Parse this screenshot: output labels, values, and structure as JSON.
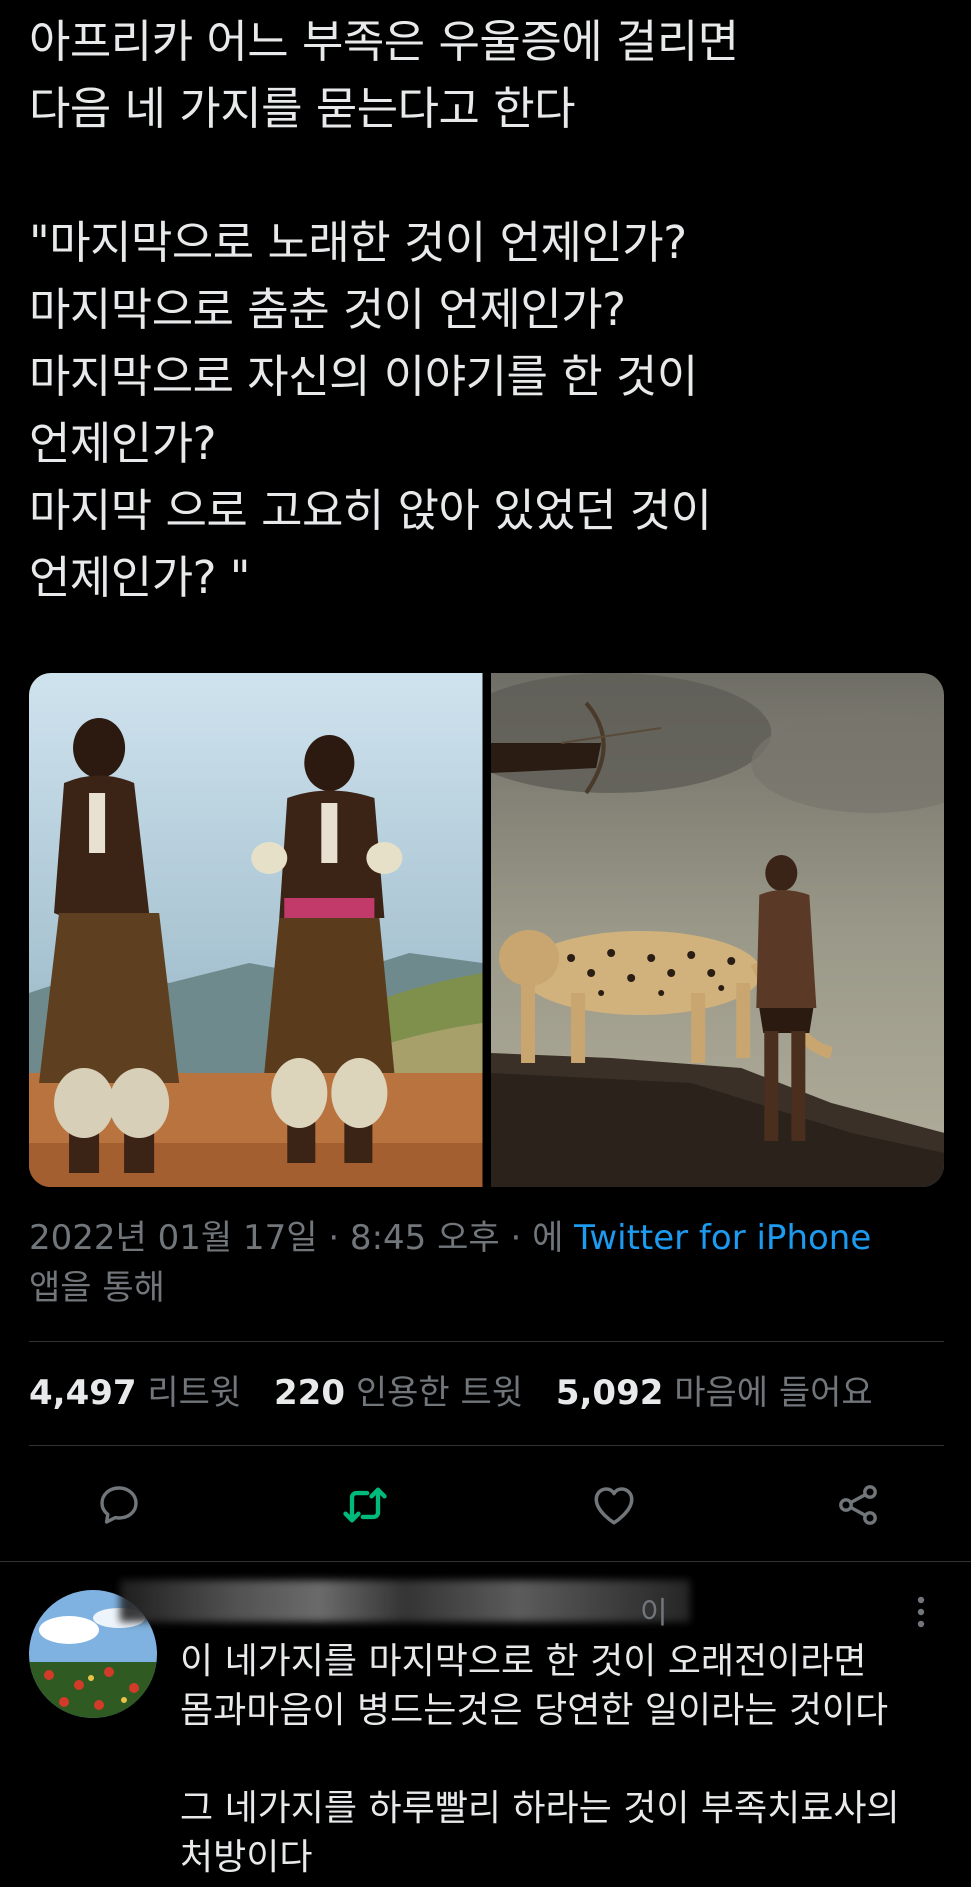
{
  "tweet": {
    "text": "아프리카 어느 부족은 우울증에 걸리면\n다음 네 가지를 묻는다고 한다\n\n\"마지막으로 노래한 것이 언제인가?\n마지막으로 춤춘 것이 언제인가?\n마지막으로 자신의 이야기를 한 것이\n언제인가?\n마지막 으로 고요히 앉아 있었던 것이\n언제인가? \"",
    "timestamp": "2022년 01월 17일 · 8:45 오후 · 에 ",
    "via": "Twitter for iPhone",
    "via_suffix": "앱을 통해"
  },
  "stats": {
    "retweets_count": "4,497",
    "retweets_label": "리트윗",
    "quotes_count": "220",
    "quotes_label": "인용한 트윗",
    "likes_count": "5,092",
    "likes_label": "마음에 들어요"
  },
  "actions": {
    "reply_icon": "comment-icon",
    "retweet_icon": "retweet-icon",
    "like_icon": "heart-icon",
    "share_icon": "share-icon",
    "retweet_color": "#00ba7c",
    "icon_color": "#71767b"
  },
  "reply": {
    "name_suffix": "이",
    "text": "이 네가지를 마지막으로 한 것이 오래전이라면\n몸과마음이 병드는것은 당연한 일이라는 것이다\n\n그 네가지를 하루빨리 하라는 것이 부족치료사의\n처방이다"
  }
}
